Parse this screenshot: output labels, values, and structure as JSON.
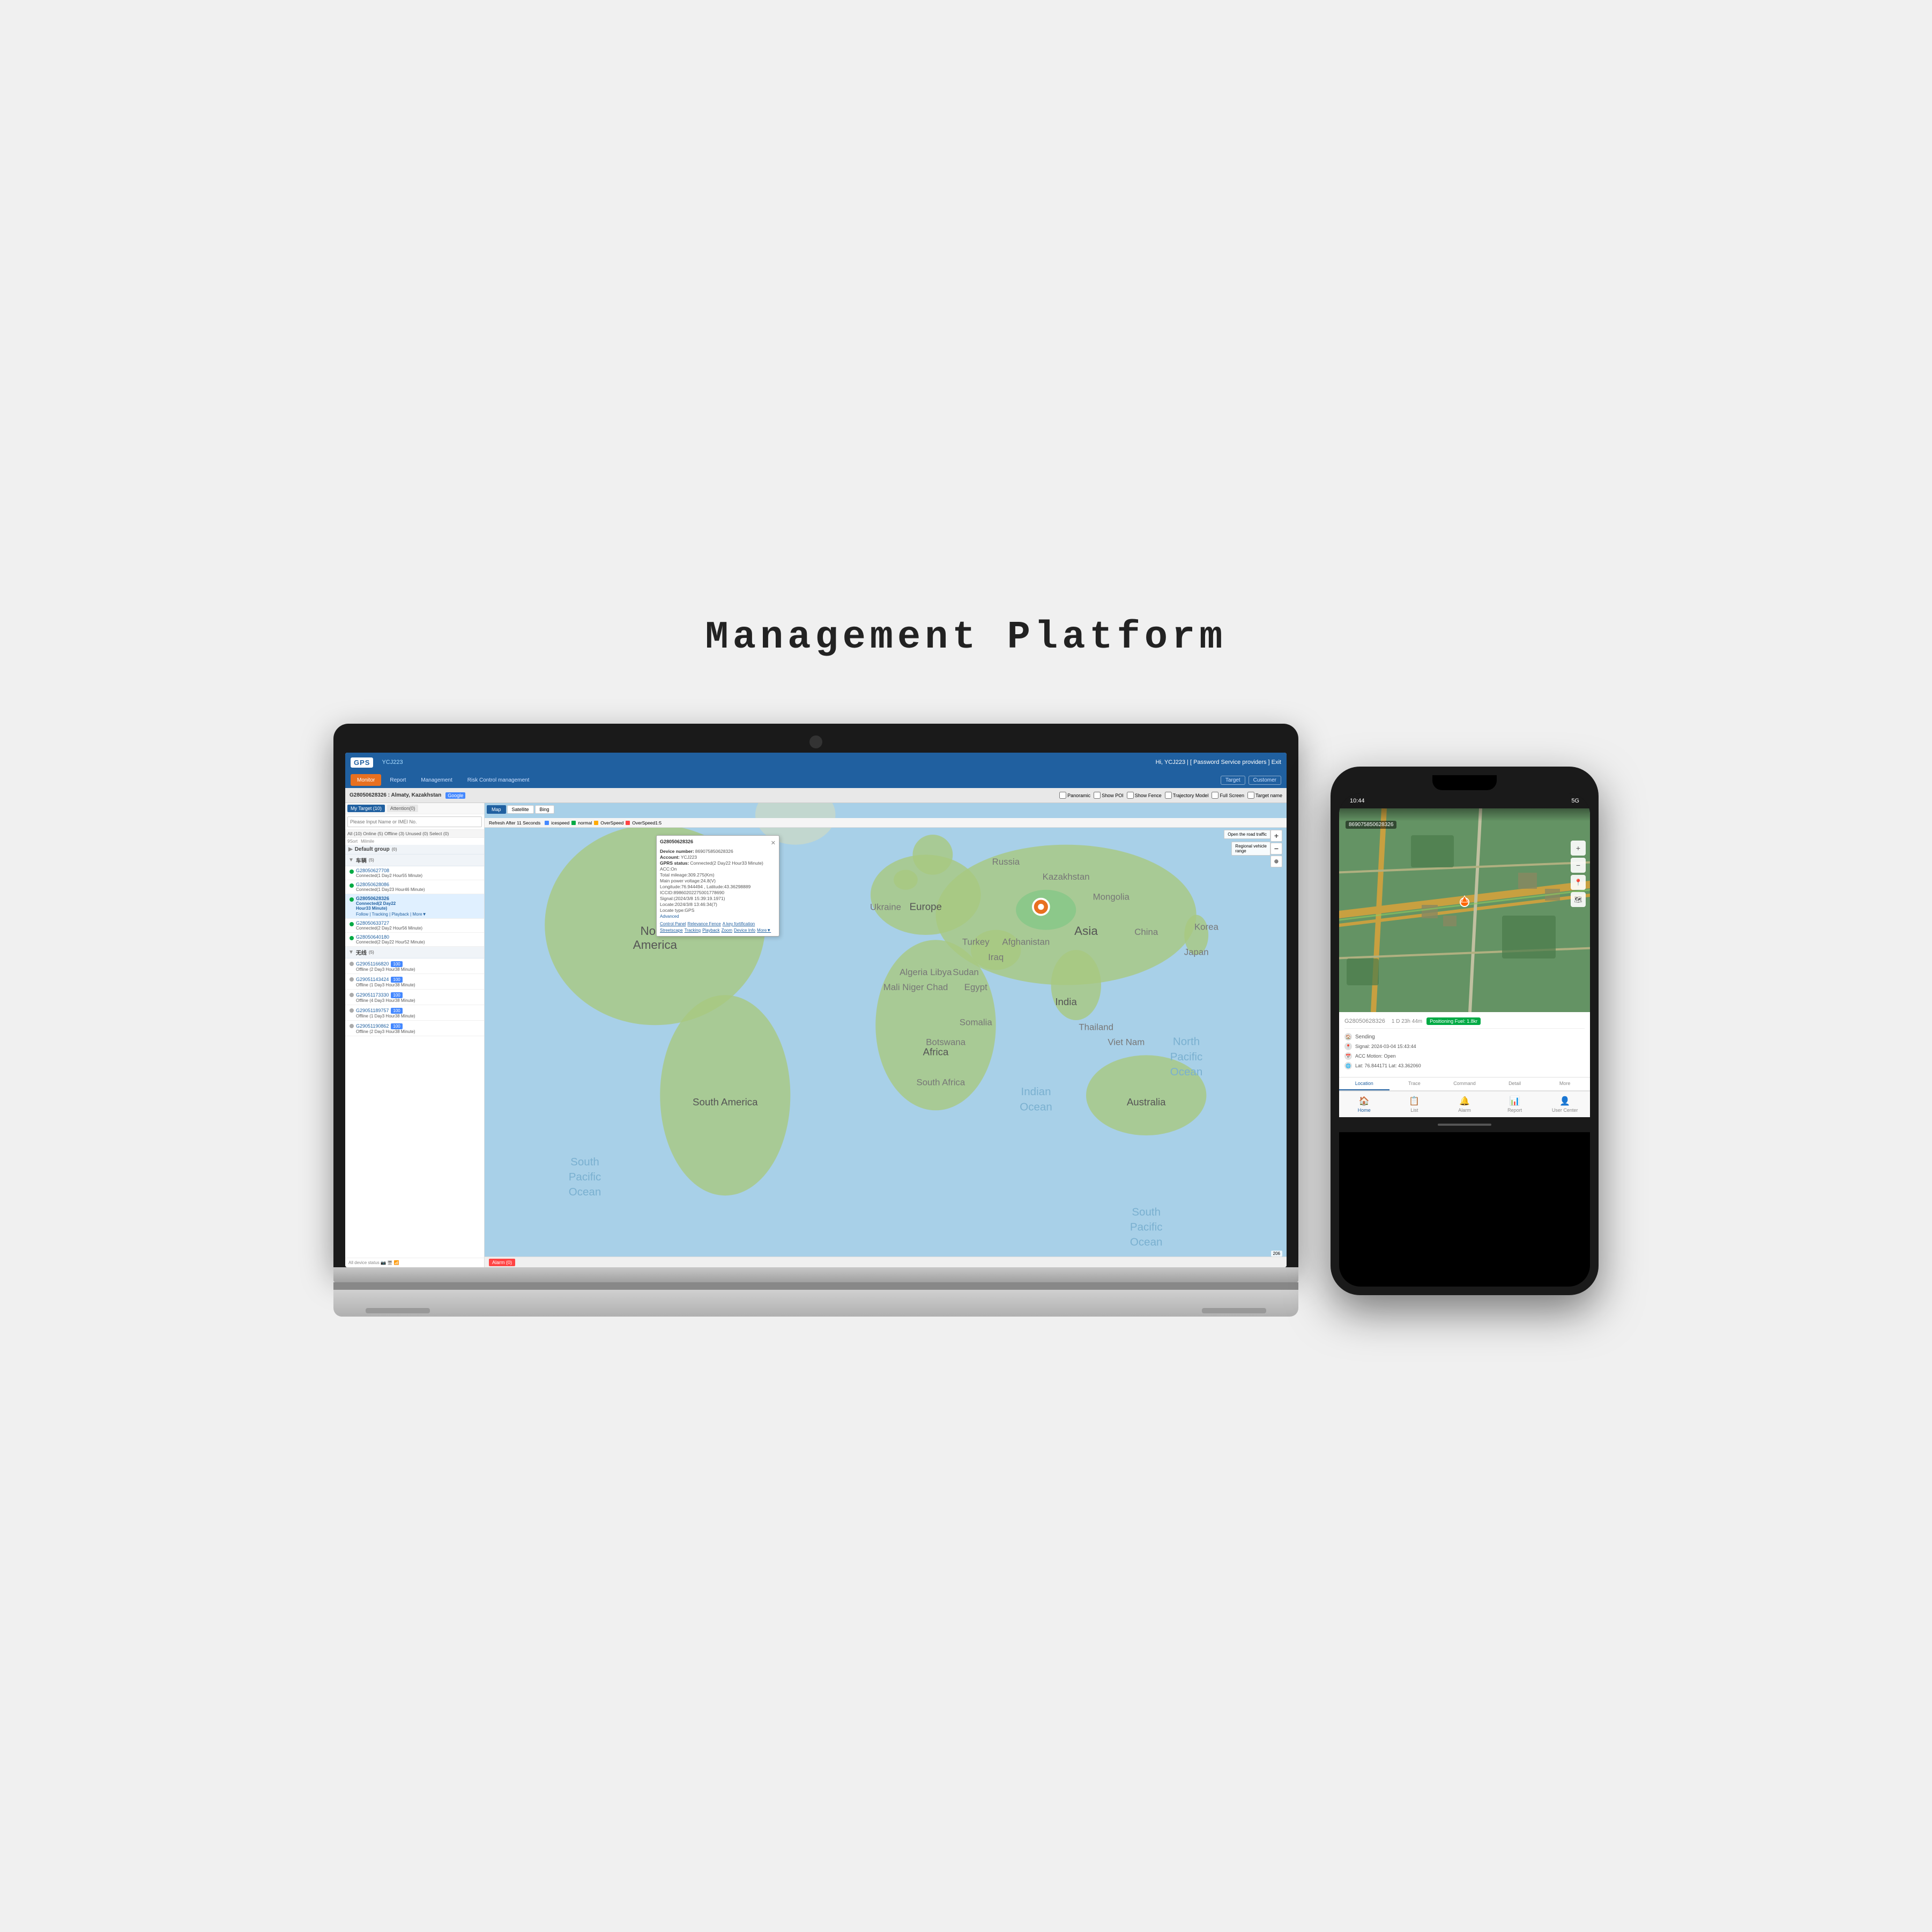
{
  "page": {
    "title": "Management Platform",
    "bg_color": "#f0f0f0"
  },
  "laptop": {
    "app": {
      "logo": "GPS",
      "username": "Hi, YCJ223 | [ Password  Service providers ] Exit",
      "nav": {
        "items": [
          {
            "label": "Monitor",
            "active": true
          },
          {
            "label": "Report",
            "active": false
          },
          {
            "label": "Management",
            "active": false
          },
          {
            "label": "Risk Control management",
            "active": false
          }
        ],
        "right": [
          {
            "label": "Target"
          },
          {
            "label": "Customer"
          }
        ]
      },
      "toolbar": {
        "location": "G28050628326 : Almaty, Kazakhstan",
        "search_engine": "Google",
        "checkboxes": [
          "Panoramic",
          "Show POI",
          "Show Fence",
          "Trajectory Model",
          "Full Screen",
          "Target name"
        ]
      },
      "refresh_bar": {
        "text": "Refresh After 11 Seconds",
        "speed_labels": [
          "icespeed",
          "normal",
          "OverSpeed",
          "OverSpeed1:5"
        ],
        "colors": [
          "#4488ff",
          "#00aa44",
          "#ffaa00",
          "#ff4444"
        ]
      },
      "sidebar": {
        "my_target_label": "My Target (10)",
        "attention_label": "Attention(0)",
        "search_placeholder": "Please Input Name or IMEI No.",
        "count_bar": "All (10)  Online (5)  Offline (3)  Unused (0)  Select (0)",
        "sort_label": "9Sort",
        "milmile_label": "Milmile",
        "groups": [
          {
            "name": "Default group",
            "count": 0,
            "expanded": true
          }
        ],
        "vehicles_group1": {
          "name": "车辆",
          "count": 5,
          "items": [
            {
              "id": "G28050627708",
              "status": "Connected(1 Day2 Hour55 Minute)",
              "connected": true,
              "active": false
            },
            {
              "id": "G28050628086",
              "status": "Connected(1 Day3 Hour46 Minute)",
              "connected": true,
              "active": false
            },
            {
              "id": "G28050628326",
              "status": "Connected(2 Day22 Hour33 Minute)",
              "connected": true,
              "active": true,
              "actions": "Follow | Tracking | Playback | More▼"
            },
            {
              "id": "G28050633727",
              "status": "Connected(2 Day2 Hour56 Minute)",
              "connected": true,
              "active": false
            },
            {
              "id": "G28050640180",
              "status": "Connected(2 Day22 Hour52 Minute)",
              "connected": true,
              "active": false
            }
          ]
        },
        "vehicles_group2": {
          "name": "无线",
          "count": 5,
          "items": [
            {
              "id": "G29051166820",
              "badge": "100",
              "status": "Offline (2 Day3 Hour38 Minute)",
              "connected": false
            },
            {
              "id": "G29051143424",
              "badge": "100",
              "status": "Offline (1 Day3 Hour38 Minute)",
              "connected": false
            },
            {
              "id": "G29051173330",
              "badge": "100",
              "status": "Offline (4 Day3 Hour38 Minute)",
              "connected": false
            },
            {
              "id": "G29051189757",
              "badge": "100",
              "status": "Offline (1 Day3 Hour38 Minute)",
              "connected": false
            },
            {
              "id": "G29051190862",
              "badge": "100",
              "status": "Offline (2 Day3 Hour38 Minute)",
              "connected": false
            }
          ]
        }
      },
      "map": {
        "tabs": [
          "Map",
          "Satellite",
          "Bing"
        ],
        "active_tab": "Map",
        "popup": {
          "device_id": "G28050628326",
          "device_number": "869075850628326",
          "account": "YCJ223",
          "gprs_status": "Connected(2 Day22 Hour33 Minute)",
          "acc": "ACC:On",
          "total_mileage": "Total mileage:309.275(Km)",
          "main_power": "Main power voltage:24.8(V)",
          "longitude": "Longitude:76.944494 , Latitude:43.36298889",
          "iccid": "ICCID:89860202275001778690",
          "signal": "Signal:(2024/3/8 15:39:19.1971)",
          "locate": "Locate:2024/3/8 13:46:34(7)",
          "locate_type": "Locate type:GPS",
          "advanced": "Advanced",
          "actions": [
            "Control Panel",
            "Relevance Fence",
            "A key fortification",
            "Streetscape",
            "Tracking",
            "Playback",
            "Zoom",
            "Device Info",
            "More▼"
          ]
        },
        "road_traffic": "Open the road traffic",
        "regional": "Regional vehicle\nrange",
        "bottom_zoom": "206"
      },
      "alarm_bar": {
        "tabs": [
          "Alarm  (0)"
        ]
      }
    }
  },
  "phone": {
    "status_bar": {
      "time": "10:44",
      "signal": "5G",
      "battery": "●●●"
    },
    "map_id": "869075850628326",
    "info": {
      "vehicle_id": "G28050628326",
      "status": "1 D 23h 44m",
      "positioning_label": "Positioning  Fuel: 1.8kr",
      "rows": [
        {
          "icon": "🏠",
          "text": "Sending"
        },
        {
          "icon": "📍",
          "text": "Signal: 2024-03-04 15:43:44   ACC Motion: Open   Lat: 76.944371 Lat: 43.362060"
        },
        {
          "icon": "📅",
          "text": "ACC Motion: Open"
        },
        {
          "icon": "📍",
          "text": "Lat: 76.844171 Lat: 43.362060"
        }
      ]
    },
    "nav_tabs": [
      {
        "label": "Location",
        "icon": "📍",
        "active": true
      },
      {
        "label": "Trace",
        "icon": "🗺"
      },
      {
        "label": "Command",
        "icon": "💬"
      },
      {
        "label": "Detail",
        "icon": "📋"
      },
      {
        "label": "More",
        "icon": "⋯"
      }
    ],
    "bottom_tabs": [
      {
        "label": "Home",
        "icon": "🏠",
        "active": true
      },
      {
        "label": "List",
        "icon": "📋"
      },
      {
        "label": "Alarm",
        "icon": "🔔"
      },
      {
        "label": "Report",
        "icon": "📊"
      },
      {
        "label": "User Center",
        "icon": "👤"
      }
    ]
  }
}
